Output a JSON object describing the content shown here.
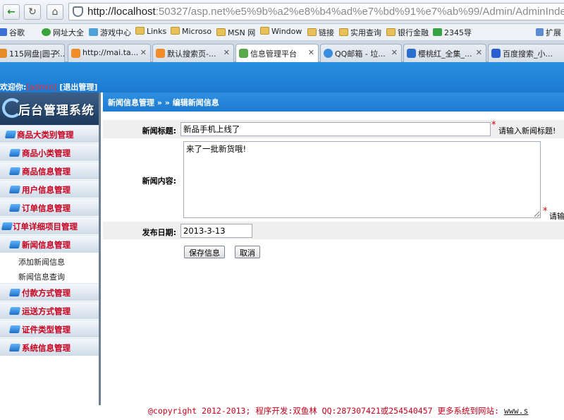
{
  "browser": {
    "url_host": "http://localhost",
    "url_rest": ":50327/asp.net%e5%9b%a2%e8%b4%ad%e7%bd%91%e7%ab%99/Admin/AdminIndex.asp",
    "bookmarks": [
      {
        "label": "谷歌",
        "icon": "google-icon",
        "color": "#3a6fd8"
      },
      {
        "label": "网址大全",
        "icon": "web-icon",
        "color": "#3aa33a"
      },
      {
        "label": "游戏中心",
        "icon": "game-icon",
        "color": "#4ea0d8"
      },
      {
        "label": "Links",
        "icon": "folder-icon"
      },
      {
        "label": "Microso",
        "icon": "folder-icon"
      },
      {
        "label": "MSN 网",
        "icon": "folder-icon"
      },
      {
        "label": "Window",
        "icon": "folder-icon"
      },
      {
        "label": "链接",
        "icon": "folder-icon"
      },
      {
        "label": "实用查询",
        "icon": "folder-icon"
      },
      {
        "label": "银行金融",
        "icon": "folder-icon"
      },
      {
        "label": "2345导",
        "icon": "site-icon",
        "color": "#36a345"
      }
    ],
    "extensions_label": "扩展",
    "tabs": [
      {
        "label": "115网盘|圆子...",
        "color": "#e58c2a"
      },
      {
        "label": "http://mai.ta...",
        "color": "#f08c2a"
      },
      {
        "label": "默认搜索页-...",
        "color": "#f08c2a"
      },
      {
        "label": "信息管理平台",
        "color": "#59a84a",
        "active": true
      },
      {
        "label": "QQ邮箱 - 垃...",
        "color": "#3a8de0"
      },
      {
        "label": "樱桃红_全集_...",
        "color": "#2a6fd0"
      },
      {
        "label": "百度搜索_小...",
        "color": "#2a5fd0"
      }
    ]
  },
  "header": {
    "welcome_prefix": "欢迎你:",
    "username": "[admin]",
    "logout": "[退出管理]"
  },
  "sidebar": {
    "logo_text": "后台管理系统",
    "items": [
      {
        "label": "商品大类别管理"
      },
      {
        "label": "商品小类管理"
      },
      {
        "label": "商品信息管理"
      },
      {
        "label": "用户信息管理"
      },
      {
        "label": "订单信息管理"
      },
      {
        "label": "订单详细项目管理"
      },
      {
        "label": "新闻信息管理",
        "sub": [
          "添加新闻信息",
          "新闻信息查询"
        ]
      },
      {
        "label": "付款方式管理"
      },
      {
        "label": "运送方式管理"
      },
      {
        "label": "证件类型管理"
      },
      {
        "label": "系统信息管理"
      }
    ]
  },
  "main": {
    "breadcrumb": "新闻信息管理 » » 编辑新闻信息",
    "form": {
      "title_label": "新闻标题:",
      "title_value": "新品手机上线了",
      "title_req": "*",
      "title_hint": "请输入新闻标题!",
      "content_label": "新闻内容:",
      "content_value": "来了一批新货哦!",
      "content_req": "*",
      "content_hint": "请输",
      "date_label": "发布日期:",
      "date_value": "2013-3-13",
      "save_button": "保存信息",
      "cancel_button": "取消"
    }
  },
  "footer": {
    "text": "@copyright 2012-2013; 程序开发:双鱼林  QQ:287307421或254540457  更多系统到网站:",
    "link": "www.s"
  }
}
